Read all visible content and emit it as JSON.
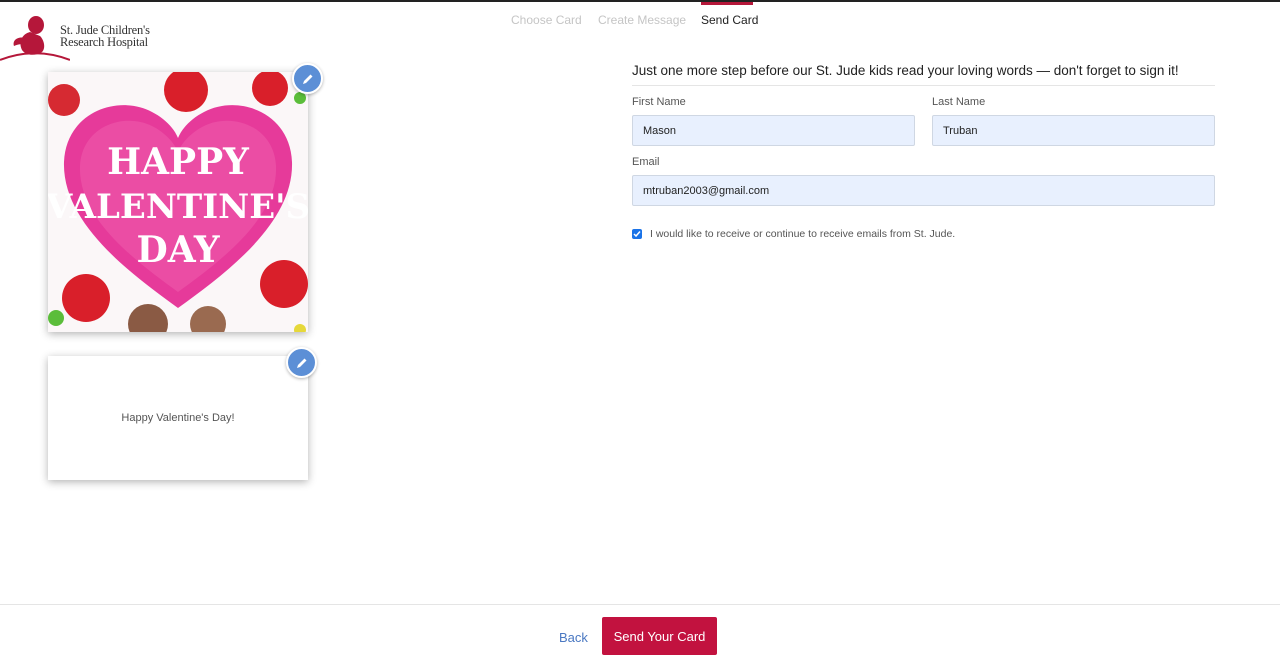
{
  "logo": {
    "line1": "St. Jude Children's",
    "line2": "Research Hospital",
    "icon": "st-jude-child-logo"
  },
  "steps": [
    {
      "label": "Choose Card",
      "active": false
    },
    {
      "label": "Create Message",
      "active": false
    },
    {
      "label": "Send Card",
      "active": true
    }
  ],
  "card": {
    "front_lines": [
      "HAPPY",
      "VALENTINE'S",
      "DAY"
    ],
    "inside_message": "Happy Valentine's Day!",
    "edit_icon": "pencil-icon"
  },
  "form": {
    "title": "Just one more step before our St. Jude kids read your loving words — don't forget to sign it!",
    "first_name_label": "First Name",
    "first_name_value": "Mason",
    "last_name_label": "Last Name",
    "last_name_value": "Truban",
    "email_label": "Email",
    "email_value": "mtruban2003@gmail.com",
    "opt_in_label": "I would like to receive or continue to receive emails from St. Jude.",
    "opt_in_checked": true
  },
  "footer": {
    "back_label": "Back",
    "send_label": "Send Your Card"
  },
  "colors": {
    "accent": "#c2123f",
    "nav_active": "#b5173a",
    "link": "#4a78c2",
    "edit": "#5c8fd6",
    "input_bg": "#e8f0fe"
  }
}
